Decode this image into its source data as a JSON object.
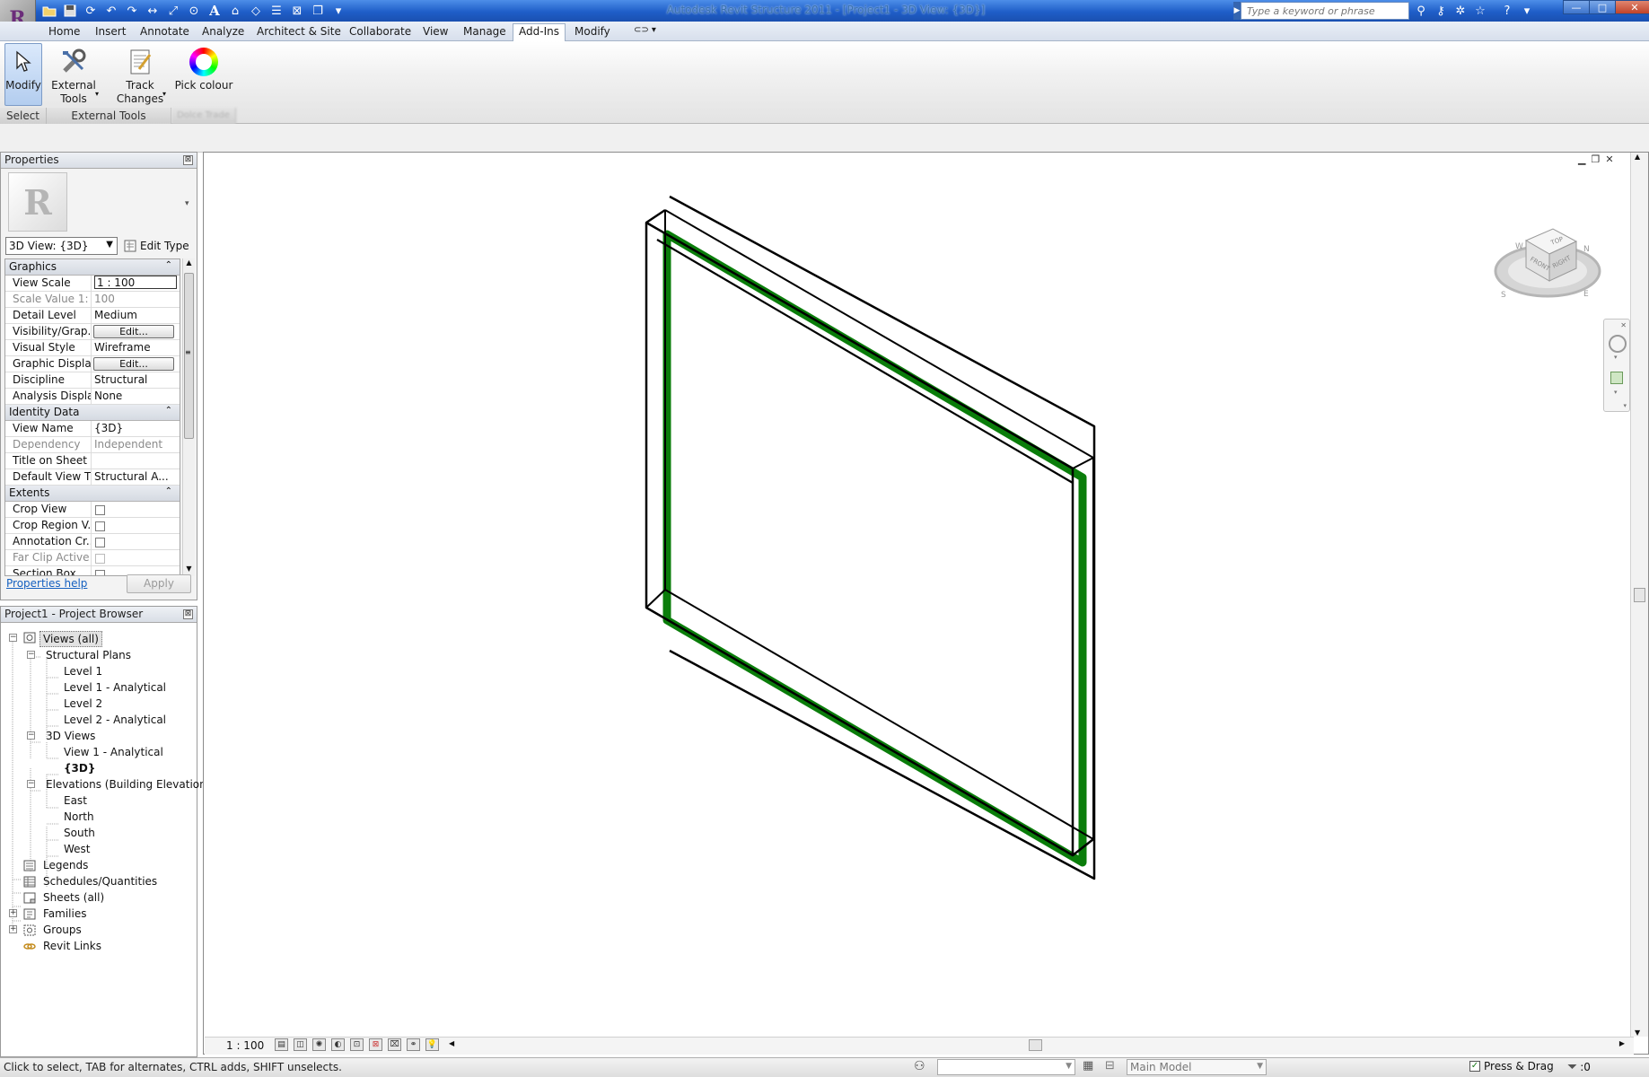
{
  "window": {
    "title": "Autodesk Revit Structure 2011 - [Project1 - 3D View: {3D}]",
    "search_placeholder": "Type a keyword or phrase",
    "minimize": "—",
    "maximize": "□",
    "close": "✕"
  },
  "app_button": {
    "letter": "R"
  },
  "ribbon": {
    "tabs": [
      "Home",
      "Insert",
      "Annotate",
      "Analyze",
      "Architect & Site",
      "Collaborate",
      "View",
      "Manage",
      "Add-Ins",
      "Modify"
    ],
    "active_tab": "Add-Ins",
    "buttons": {
      "modify": "Modify",
      "external_tools_line1": "External",
      "external_tools_line2": "Tools",
      "track_changes_line1": "Track",
      "track_changes_line2": "Changes",
      "pick_colour": "Pick colour"
    },
    "panels": {
      "select": "Select",
      "external_tools": "External Tools",
      "third": "Dolce Trade"
    }
  },
  "properties": {
    "title": "Properties",
    "type_selector": "3D View: {3D}",
    "edit_type": "Edit Type",
    "groups": {
      "graphics": "Graphics",
      "identity": "Identity Data",
      "extents": "Extents"
    },
    "rows": {
      "view_scale": {
        "label": "View Scale",
        "value": "1 : 100"
      },
      "scale_value": {
        "label": "Scale Value    1:",
        "value": "100"
      },
      "detail_level": {
        "label": "Detail Level",
        "value": "Medium"
      },
      "visibility": {
        "label": "Visibility/Grap...",
        "value": "Edit..."
      },
      "visual_style": {
        "label": "Visual Style",
        "value": "Wireframe"
      },
      "graphic_display": {
        "label": "Graphic Displa...",
        "value": "Edit..."
      },
      "discipline": {
        "label": "Discipline",
        "value": "Structural"
      },
      "analysis_display": {
        "label": "Analysis Displa...",
        "value": "None"
      },
      "view_name": {
        "label": "View Name",
        "value": "{3D}"
      },
      "dependency": {
        "label": "Dependency",
        "value": "Independent"
      },
      "title_on_sheet": {
        "label": "Title on Sheet",
        "value": ""
      },
      "default_view_template": {
        "label": "Default View T...",
        "value": "Structural A..."
      },
      "crop_view": {
        "label": "Crop View"
      },
      "crop_region": {
        "label": "Crop Region V..."
      },
      "annotation_crop": {
        "label": "Annotation Cr..."
      },
      "far_clip": {
        "label": "Far Clip Active"
      },
      "section_box": {
        "label": "Section Box"
      }
    },
    "help": "Properties help",
    "apply": "Apply"
  },
  "browser": {
    "title": "Project1 - Project Browser",
    "views_all": "Views (all)",
    "structural_plans": "Structural Plans",
    "level1": "Level 1",
    "level1_analytical": "Level 1 - Analytical",
    "level2": "Level 2",
    "level2_analytical": "Level 2 - Analytical",
    "views_3d": "3D Views",
    "view1_analytical": "View 1 - Analytical",
    "view_3d": "{3D}",
    "elevations": "Elevations (Building Elevation)",
    "east": "East",
    "north": "North",
    "south": "South",
    "west": "West",
    "legends": "Legends",
    "schedules": "Schedules/Quantities",
    "sheets": "Sheets (all)",
    "families": "Families",
    "groups": "Groups",
    "revit_links": "Revit Links"
  },
  "viewcube": {
    "top": "TOP",
    "front": "FRONT",
    "right": "RIGHT",
    "n": "N",
    "s": "S",
    "e": "E",
    "w": "W"
  },
  "view_bar": {
    "scale": "1 : 100"
  },
  "status": {
    "message": "Click to select, TAB for alternates, CTRL adds, SHIFT unselects.",
    "model": "Main Model",
    "press_drag": "Press & Drag",
    "filter_count": ":0"
  },
  "colors": {
    "beam": "#0a7d0a",
    "titlebar": "#1f5ec8"
  }
}
